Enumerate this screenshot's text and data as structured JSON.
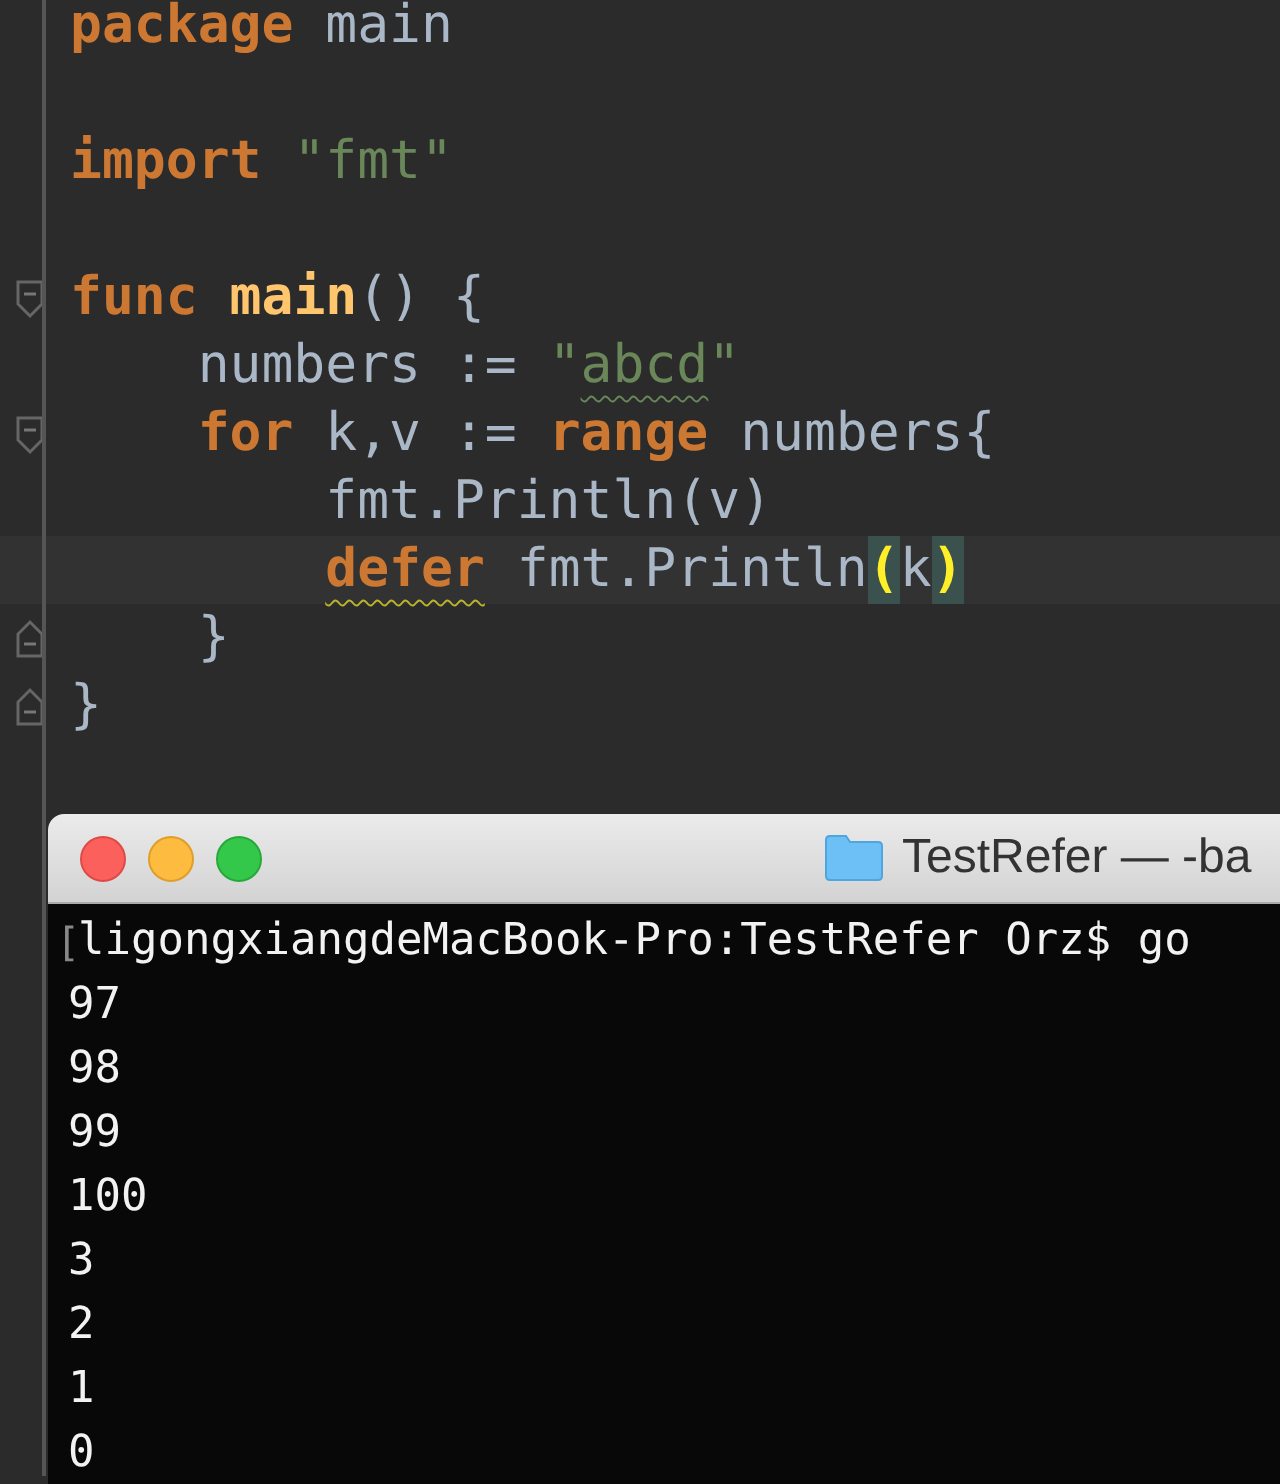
{
  "editor": {
    "lines": [
      {
        "tokens": [
          {
            "kind": "kw",
            "text": "package"
          },
          {
            "kind": "plain",
            "text": " main"
          }
        ]
      },
      {
        "blank_before": true,
        "tokens": [
          {
            "kind": "kw",
            "text": "import"
          },
          {
            "kind": "str",
            "text": " \"fmt\""
          }
        ]
      },
      {
        "blank_before": true,
        "fold_open": true,
        "tokens": [
          {
            "kind": "kw",
            "text": "func"
          },
          {
            "kind": "fn",
            "text": " main"
          },
          {
            "kind": "plain",
            "text": "() {"
          }
        ],
        "children": [
          {
            "tokens": [
              {
                "kind": "plain",
                "text": "numbers := "
              },
              {
                "kind": "str",
                "text": "\""
              },
              {
                "kind": "str",
                "text": "abcd",
                "warning": true
              },
              {
                "kind": "str",
                "text": "\""
              }
            ]
          },
          {
            "fold_open": true,
            "tokens": [
              {
                "kind": "kw",
                "text": "for"
              },
              {
                "kind": "plain",
                "text": " k,v := "
              },
              {
                "kind": "kw",
                "text": "range"
              },
              {
                "kind": "plain",
                "text": " numbers{"
              }
            ],
            "children": [
              {
                "tokens": [
                  {
                    "kind": "plain",
                    "text": "fmt.Println(v)"
                  }
                ]
              },
              {
                "current": true,
                "tokens": [
                  {
                    "kind": "kw",
                    "text": "defer",
                    "warning": true
                  },
                  {
                    "kind": "plain",
                    "text": " fmt.Println"
                  },
                  {
                    "kind": "match",
                    "text": "("
                  },
                  {
                    "kind": "plain",
                    "text": "k"
                  },
                  {
                    "kind": "match",
                    "text": ")"
                  }
                ]
              }
            ]
          },
          {
            "fold_close": true,
            "tokens": [
              {
                "kind": "plain",
                "text": "}"
              }
            ]
          }
        ]
      },
      {
        "fold_close": true,
        "tokens": [
          {
            "kind": "plain",
            "text": "}"
          }
        ]
      }
    ]
  },
  "terminal": {
    "title": "TestRefer — -ba",
    "prompt_mark": "[",
    "lines": [
      "ligongxiangdeMacBook-Pro:TestRefer Orz$ go",
      "97",
      "98",
      "99",
      "100",
      "3",
      "2",
      "1",
      "0"
    ]
  }
}
